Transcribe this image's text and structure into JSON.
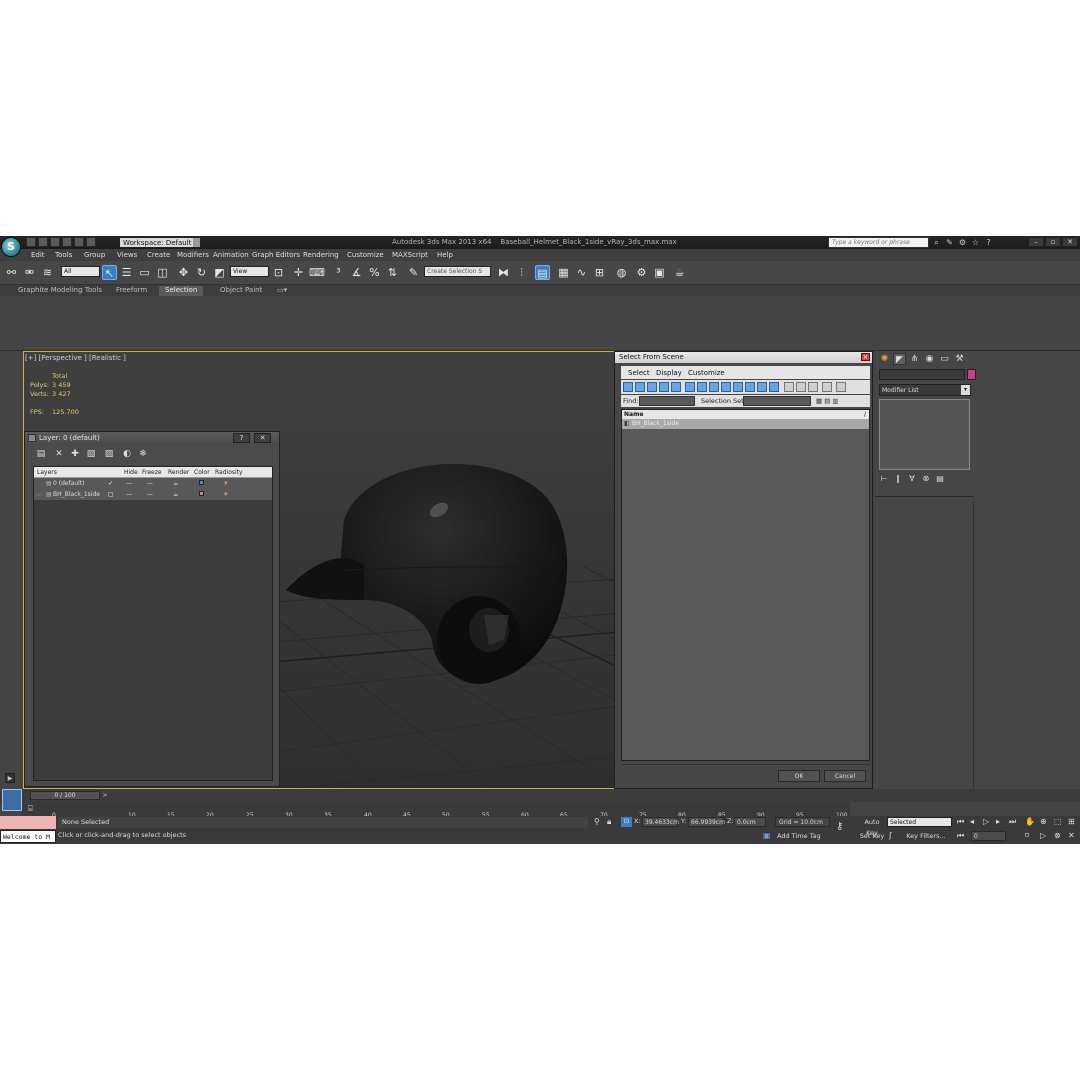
{
  "window": {
    "app_title": "Autodesk 3ds Max  2013 x64",
    "file_name": "Baseball_Helmet_Black_1side_vRay_3ds_max.max",
    "workspace": "Workspace: Default",
    "search_placeholder": "Type a keyword or phrase"
  },
  "menu": [
    "Edit",
    "Tools",
    "Group",
    "Views",
    "Create",
    "Modifiers",
    "Animation",
    "Graph Editors",
    "Rendering",
    "Customize",
    "MAXScript",
    "Help"
  ],
  "toolbar": {
    "selection_filter": "All",
    "ref_coord": "View",
    "named_selection_placeholder": "Create Selection S"
  },
  "ribbon_tabs": [
    "Graphite Modeling Tools",
    "Freeform",
    "Selection",
    "Object Paint"
  ],
  "viewport": {
    "label": "[+] [Perspective ] [Realistic ]",
    "stats_header": "Total",
    "polys_label": "Polys:",
    "polys_value": "3 459",
    "verts_label": "Verts:",
    "verts_value": "3 427",
    "fps_label": "FPS:",
    "fps_value": "125.700"
  },
  "layer_dialog": {
    "title": "Layer: 0 (default)",
    "help": "?",
    "close": "✕",
    "columns": [
      "Layers",
      "Hide",
      "Freeze",
      "Render",
      "Color",
      "Radiosity"
    ],
    "rows": [
      {
        "name": "0 (default)",
        "hide": "—",
        "freeze": "—",
        "color": "#4a8fd6"
      },
      {
        "name": "BH_Black_1side",
        "hide": "—",
        "freeze": "—",
        "color": "#e07a8a"
      }
    ]
  },
  "select_from_scene": {
    "title": "Select From Scene",
    "menu": [
      "Select",
      "Display",
      "Customize"
    ],
    "find_label": "Find:",
    "selection_set_label": "Selection Set:",
    "name_column": "Name",
    "items": [
      "BH_Black_1side"
    ],
    "ok": "OK",
    "cancel": "Cancel"
  },
  "command_panel": {
    "modifier_list": "Modifier List",
    "object_color": "#c73e8a"
  },
  "timeline": {
    "slider": "0 / 100",
    "ticks": [
      "0",
      "10",
      "15",
      "20",
      "25",
      "30",
      "35",
      "40",
      "45",
      "50",
      "55",
      "60",
      "65",
      "70",
      "75",
      "80",
      "85",
      "90",
      "95",
      "100"
    ]
  },
  "status": {
    "maxscript_listener": "Welcome to M",
    "selection": "None Selected",
    "prompt": "Click or click-and-drag to select objects",
    "x_label": "X:",
    "x_value": "39.4633cm",
    "y_label": "Y:",
    "y_value": "66.9939cm",
    "z_label": "Z:",
    "z_value": "0.0cm",
    "grid": "Grid = 10.0cm",
    "add_time_tag": "Add Time Tag",
    "auto_key": "Auto Key",
    "set_key": "Set Key",
    "key_mode": "Selected",
    "key_filters": "Key Filters...",
    "frame": "0"
  }
}
